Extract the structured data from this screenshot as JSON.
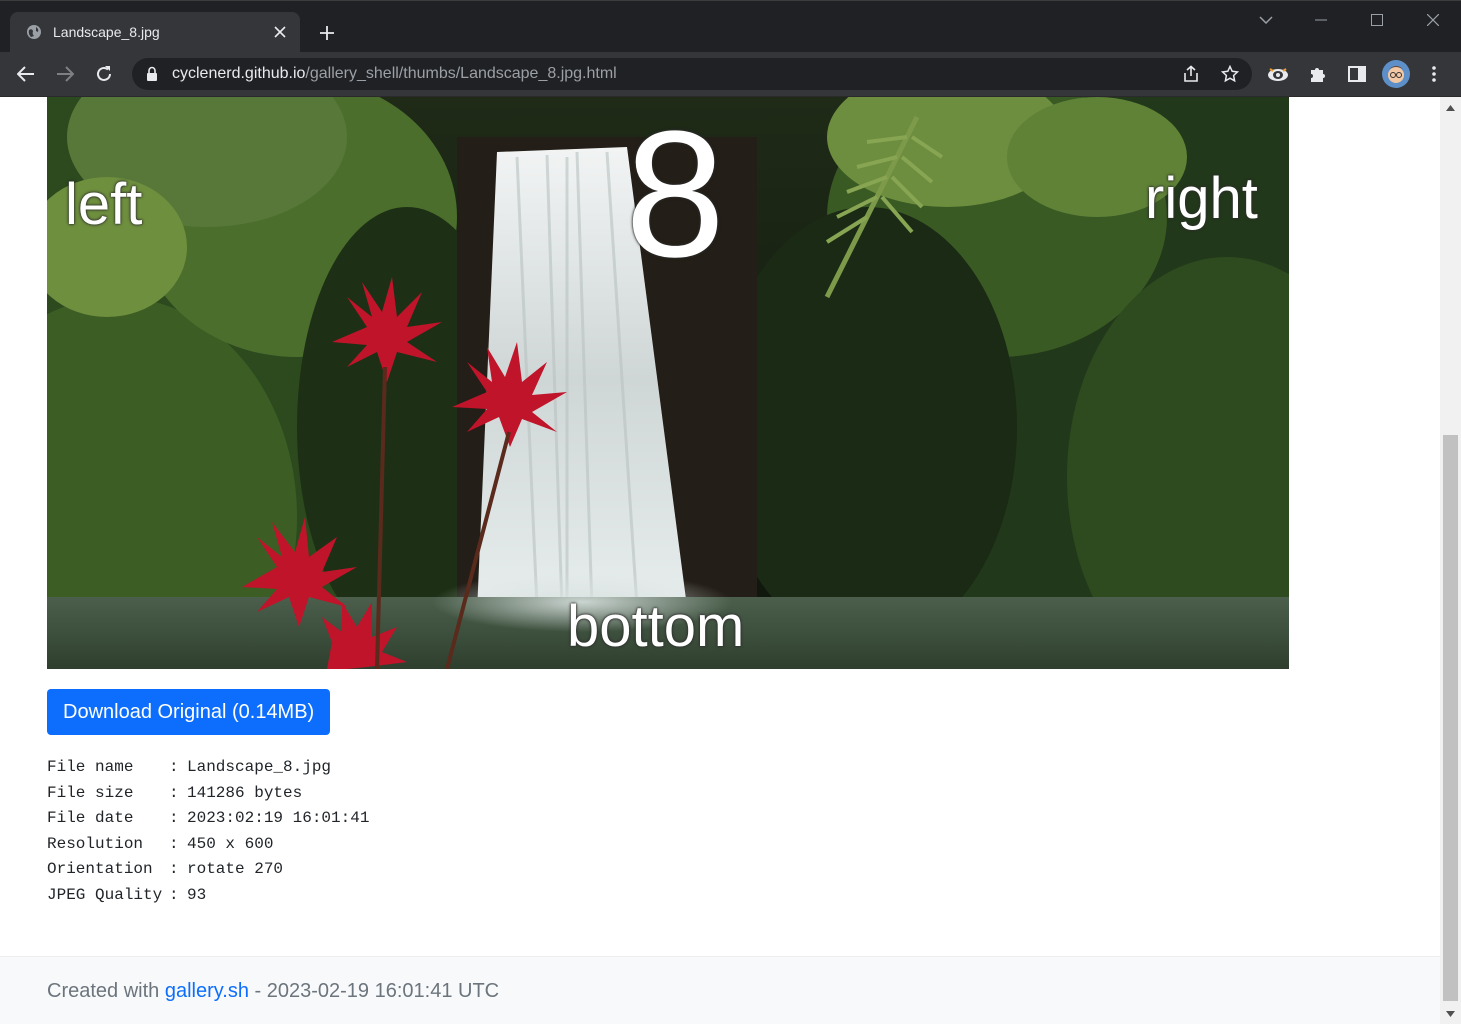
{
  "browser": {
    "tab_title": "Landscape_8.jpg",
    "url_host": "cyclenerd.github.io",
    "url_path": "/gallery_shell/thumbs/Landscape_8.jpg.html"
  },
  "photo": {
    "labels": {
      "top": "8",
      "left": "left",
      "right": "right",
      "bottom": "bottom"
    }
  },
  "download": {
    "label": "Download Original (0.14MB)"
  },
  "info": [
    {
      "key": "File name",
      "value": "Landscape_8.jpg"
    },
    {
      "key": "File size",
      "value": "141286 bytes"
    },
    {
      "key": "File date",
      "value": "2023:02:19 16:01:41"
    },
    {
      "key": "Resolution",
      "value": "450 x 600"
    },
    {
      "key": "Orientation",
      "value": "rotate 270"
    },
    {
      "key": "JPEG Quality",
      "value": "93"
    }
  ],
  "footer": {
    "prefix": "Created with ",
    "link_text": "gallery.sh",
    "suffix": " - 2023-02-19 16:01:41 UTC"
  },
  "colors": {
    "primary": "#0d6efd",
    "chrome_dark": "#202124",
    "chrome_toolbar": "#35363a"
  },
  "icons": {
    "favicon": "globe-icon",
    "back": "arrow-left-icon",
    "forward": "arrow-right-icon",
    "reload": "reload-icon",
    "lock": "lock-icon",
    "share": "share-icon",
    "bookmark": "star-icon",
    "extension": "puzzle-icon",
    "side_panel": "side-panel-icon",
    "menu": "kebab-menu-icon"
  }
}
